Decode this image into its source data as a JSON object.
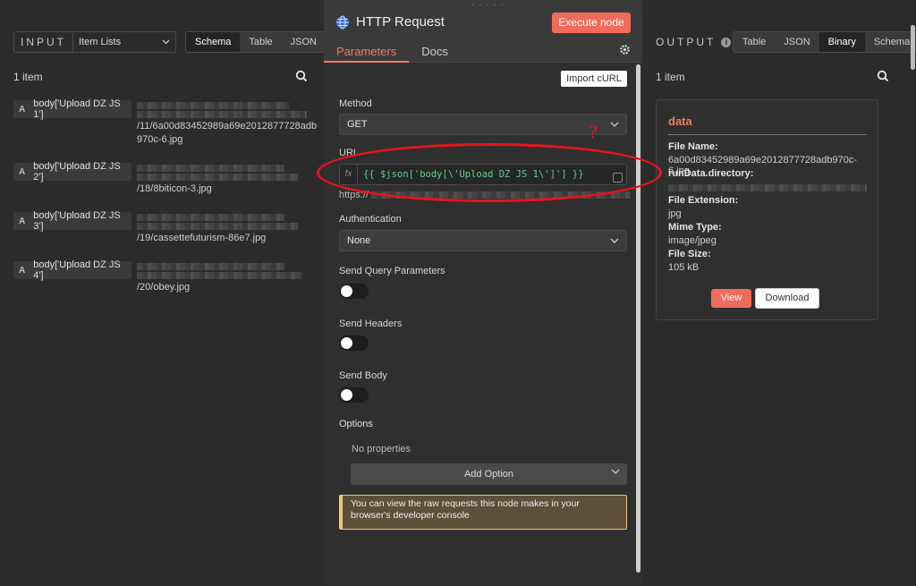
{
  "input": {
    "label": "INPUT",
    "select": "Item Lists",
    "tabs": [
      "Schema",
      "Table",
      "JSON"
    ],
    "count": "1 item",
    "rows": [
      {
        "type": "A",
        "key": "body['Upload DZ JS 1']",
        "lines": [
          "/11/6a00d83452989a69e2012877728adb",
          "970c-6.jpg"
        ]
      },
      {
        "type": "A",
        "key": "body['Upload DZ JS 2']",
        "lines": [
          "/18/8biticon-3.jpg"
        ]
      },
      {
        "type": "A",
        "key": "body['Upload DZ JS 3']",
        "lines": [
          "/19/cassettefuturism-86e7.jpg"
        ]
      },
      {
        "type": "A",
        "key": "body['Upload DZ JS 4']",
        "lines": [
          "/20/obey.jpg"
        ]
      }
    ]
  },
  "node": {
    "title": "HTTP Request",
    "execute": "Execute node",
    "tabs": [
      "Parameters",
      "Docs"
    ],
    "import": "Import cURL",
    "method_label": "Method",
    "method_value": "GET",
    "url_label": "URL",
    "url_fx": "fx",
    "url_expression": "{{ $json['body[\\'Upload DZ JS 1\\']'] }}",
    "url_hint": "https://",
    "auth_label": "Authentication",
    "auth_value": "None",
    "query_label": "Send Query Parameters",
    "headers_label": "Send Headers",
    "body_label": "Send Body",
    "options_label": "Options",
    "no_props": "No properties",
    "add_option": "Add Option",
    "notice": "You can view the raw requests this node makes in your browser's developer console"
  },
  "annotation": {
    "mark": "?",
    "color": "#e8141b"
  },
  "output": {
    "label": "OUTPUT",
    "info": "i",
    "tabs": [
      "Table",
      "JSON",
      "Binary",
      "Schema"
    ],
    "count": "1 item",
    "card_title": "data",
    "file_name_label": "File Name:",
    "file_name": "6a00d83452989a69e2012877728adb970c-6.jpg",
    "dir_label": "runData.directory:",
    "ext_label": "File Extension:",
    "ext": "jpg",
    "mime_label": "Mime Type:",
    "mime": "image/jpeg",
    "size_label": "File Size:",
    "size": "105 kB",
    "view": "View",
    "download": "Download"
  },
  "colors": {
    "accent": "#ef6b5a",
    "success_code": "#5ed192",
    "notice_border": "#e6c983"
  }
}
